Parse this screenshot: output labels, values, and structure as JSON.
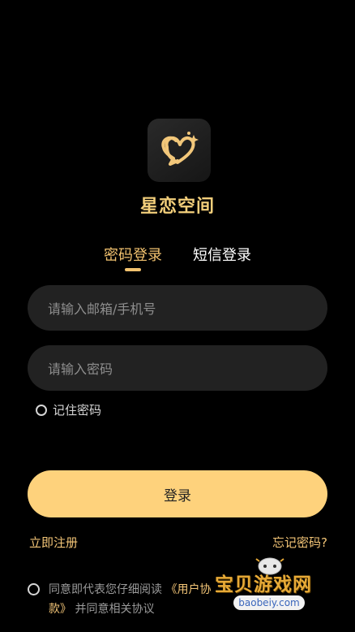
{
  "app": {
    "name": "星恋空间"
  },
  "tabs": [
    {
      "label": "密码登录"
    },
    {
      "label": "短信登录"
    }
  ],
  "form": {
    "email_placeholder": "请输入邮箱/手机号",
    "password_placeholder": "请输入密码",
    "remember_label": "记住密码",
    "login_label": "登录",
    "register_label": "立即注册",
    "forgot_label": "忘记密码?"
  },
  "agreement": {
    "prefix": "同意即代表您仔细阅读",
    "user_protocol": "《用户协",
    "privacy_policy": "款》",
    "suffix": "并同意相关协议"
  },
  "watermark": {
    "title": "宝贝游戏网",
    "url": "baobeiy.com"
  },
  "colors": {
    "accent": "#fed27c",
    "text_accent": "#f3c577",
    "field_bg": "#222222"
  },
  "icons": {
    "logo": "heart-chat-logo-icon"
  }
}
